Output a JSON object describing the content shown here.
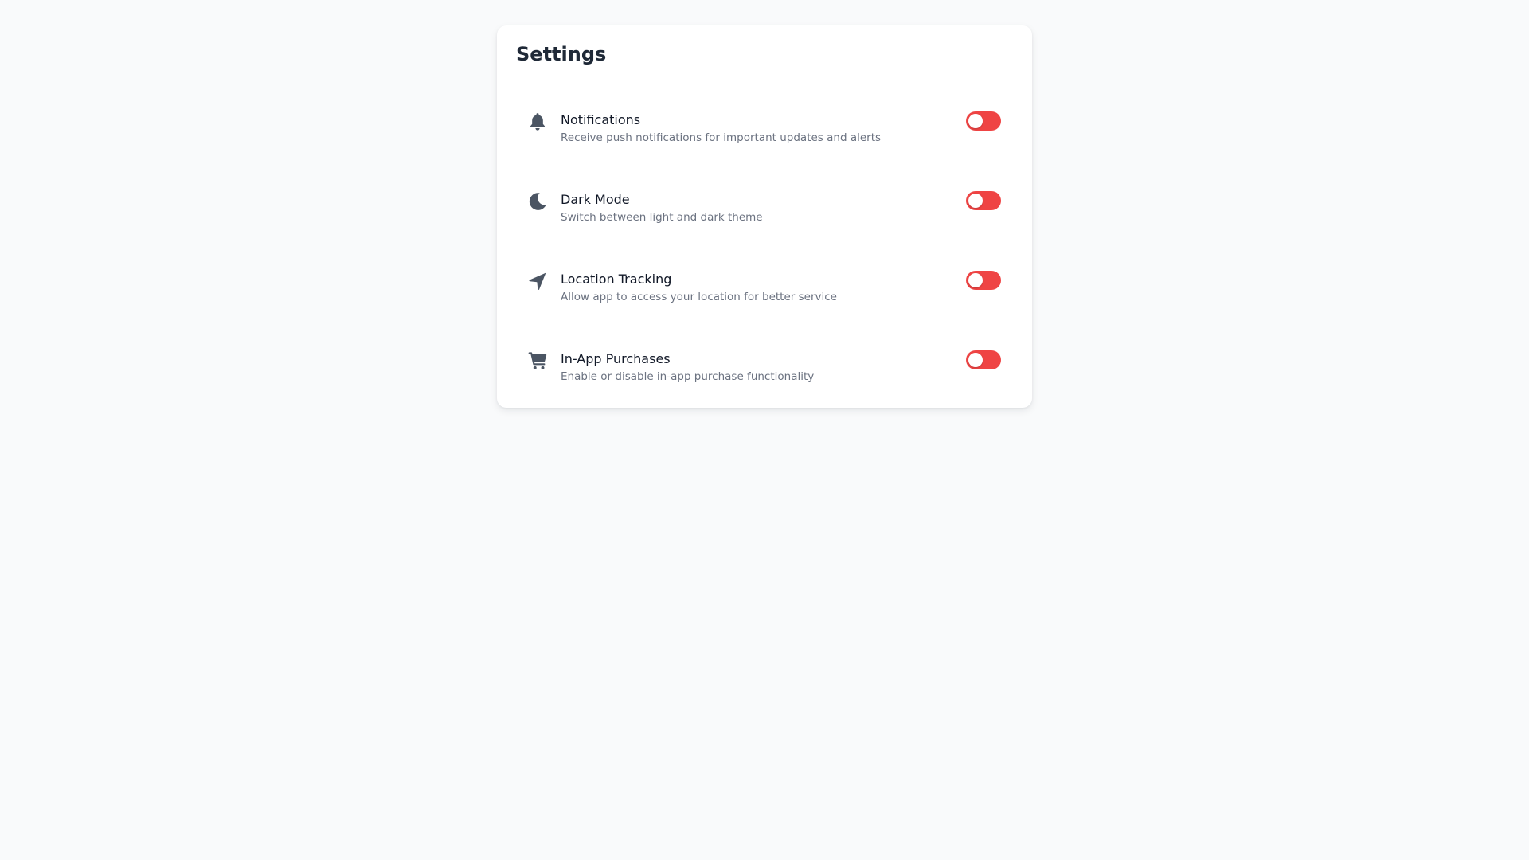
{
  "settings": {
    "title": "Settings",
    "items": [
      {
        "icon": "bell-icon",
        "label": "Notifications",
        "description": "Receive push notifications for important updates and alerts",
        "enabled": false
      },
      {
        "icon": "moon-icon",
        "label": "Dark Mode",
        "description": "Switch between light and dark theme",
        "enabled": false
      },
      {
        "icon": "location-arrow-icon",
        "label": "Location Tracking",
        "description": "Allow app to access your location for better service",
        "enabled": false
      },
      {
        "icon": "shopping-cart-icon",
        "label": "In-App Purchases",
        "description": "Enable or disable in-app purchase functionality",
        "enabled": false
      }
    ]
  },
  "colors": {
    "background": "#f9fafb",
    "card": "#ffffff",
    "toggle_off": "#ef4444",
    "icon": "#4b5563",
    "label": "#111827",
    "description": "#6b7280"
  }
}
